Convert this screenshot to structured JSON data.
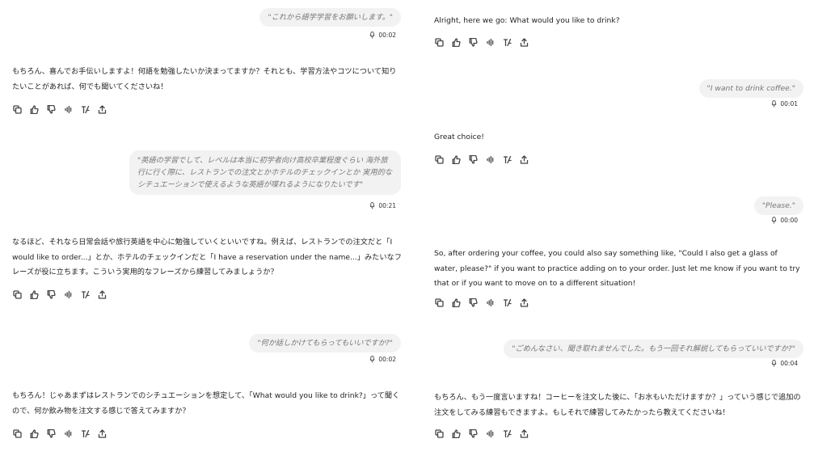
{
  "left": {
    "u1": {
      "text": "\"これから語学学習をお願いします。\"",
      "duration": "00:02"
    },
    "a1": {
      "text": "もちろん、喜んでお手伝いしますよ！何語を勉強したいか決まってますか？それとも、学習方法やコツについて知りたいことがあれば、何でも聞いてくださいね！"
    },
    "u2": {
      "text": "\"英語の学習でして、レベルは本当に初学者向け高校卒業程度ぐらい 海外旅行に行く際に、レストランでの注文とかホテルのチェックインとか 実用的なシチュエーションで使えるような英語が喋れるようになりたいです\"",
      "duration": "00:21"
    },
    "a2": {
      "text": "なるほど、それなら日常会話や旅行英語を中心に勉強していくといいですね。例えば、レストランでの注文だと「I would like to order...」とか、ホテルのチェックインだと「I have a reservation under the name...」みたいなフレーズが役に立ちます。こういう実用的なフレーズから練習してみましょうか？"
    },
    "u3": {
      "text": "\"何か話しかけてもらってもいいですか?\"",
      "duration": "00:02"
    },
    "a3": {
      "text": "もちろん！じゃあまずはレストランでのシチュエーションを想定して、「What would you like to drink?」って聞くので、何か飲み物を注文する感じで答えてみますか？"
    }
  },
  "right": {
    "a1": {
      "text": "Alright, here we go: What would you like to drink?"
    },
    "u1": {
      "text": "\"I want to drink coffee.\"",
      "duration": "00:01"
    },
    "a2": {
      "text": "Great choice!"
    },
    "u2": {
      "text": "\"Please.\"",
      "duration": "00:00"
    },
    "a3": {
      "text": "So, after ordering your coffee, you could also say something like, \"Could I also get a glass of water, please?\" if you want to practice adding on to your order. Just let me know if you want to try that or if you want to move on to a different situation!"
    },
    "u3": {
      "text": "\"ごめんなさい、聞き取れませんでした。もう一回それ解説してもらっていいですか?\"",
      "duration": "00:04"
    },
    "a4": {
      "text": "もちろん、もう一度言いますね！コーヒーを注文した後に、「お水もいただけますか？」っていう感じで追加の注文をしてみる練習もできますよ。もしそれで練習してみたかったら教えてくださいね！"
    }
  },
  "icons": [
    "copy-icon",
    "thumbs-up-icon",
    "thumbs-down-icon",
    "read-aloud-icon",
    "regenerate-icon",
    "share-icon"
  ]
}
